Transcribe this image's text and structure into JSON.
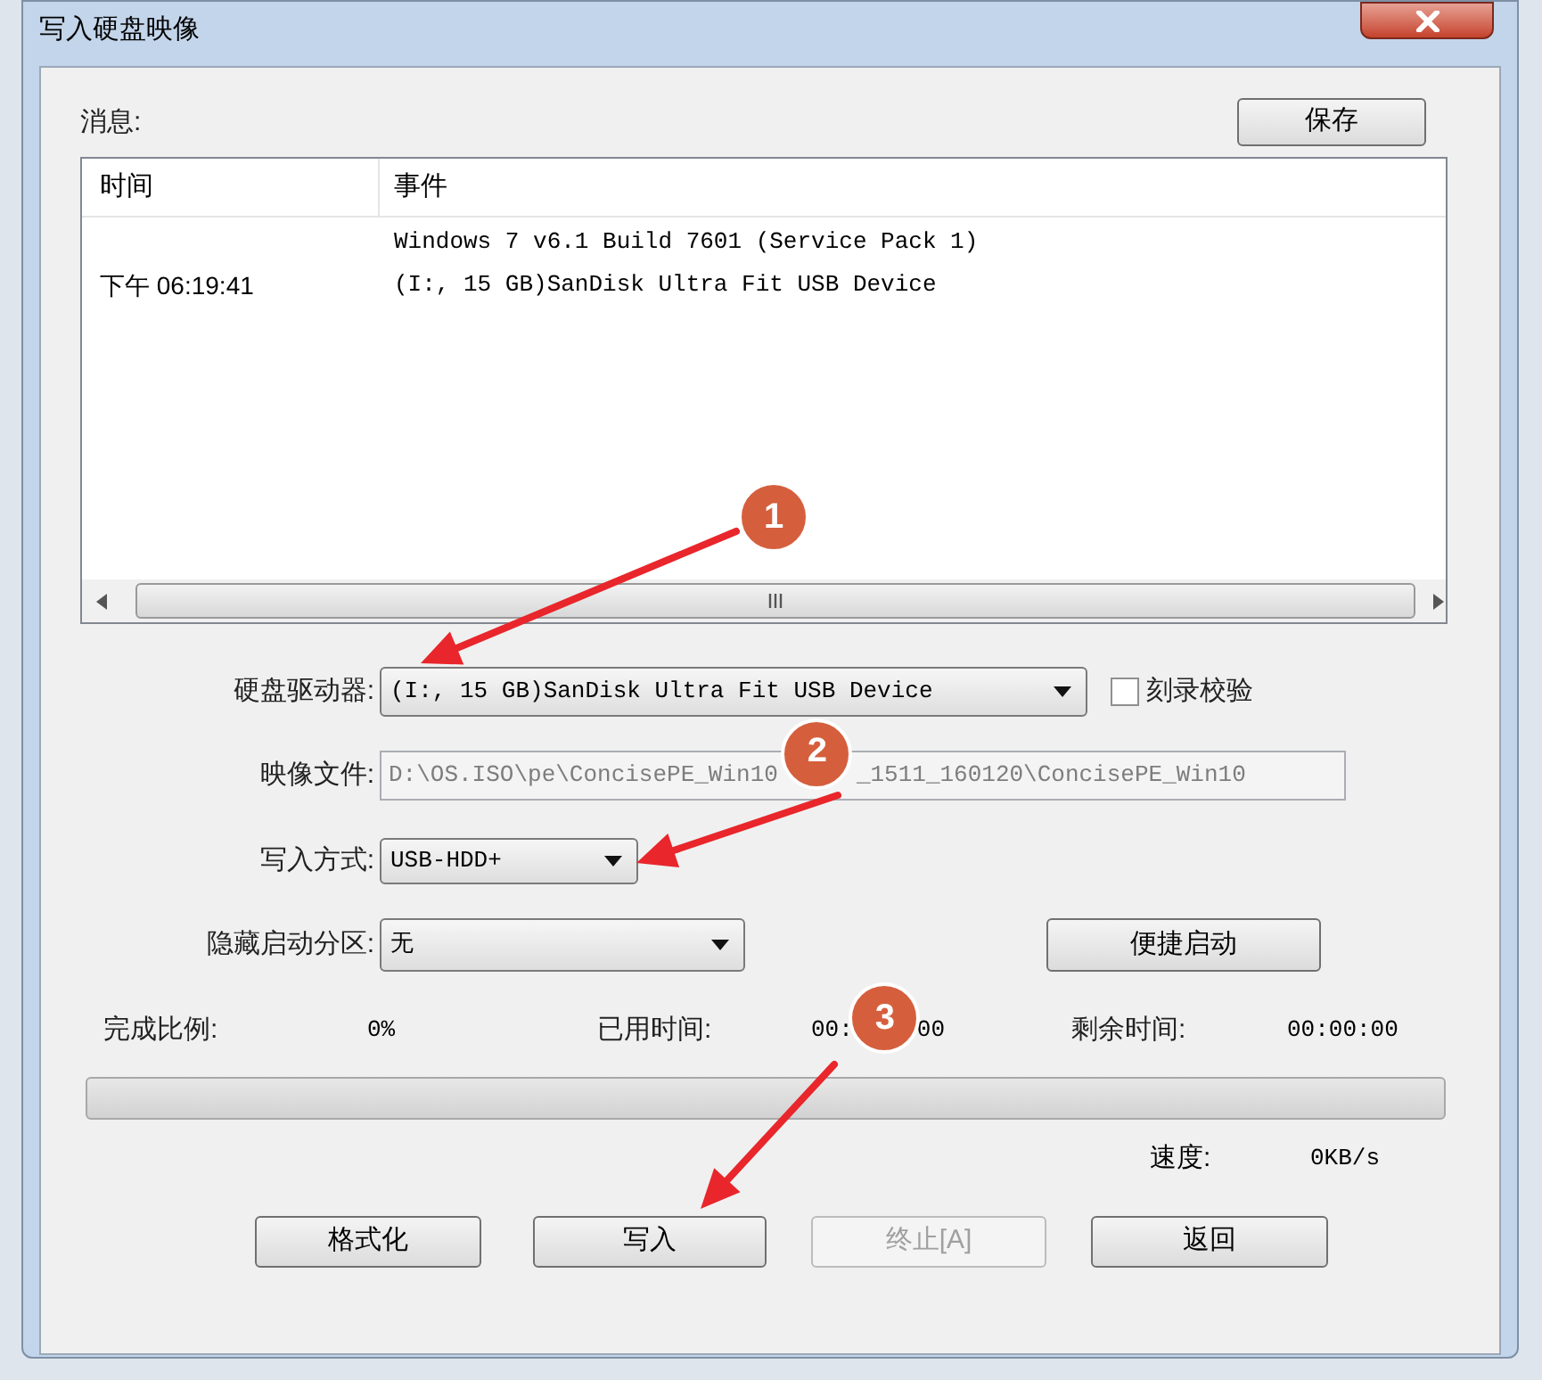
{
  "window": {
    "title": "写入硬盘映像"
  },
  "messages": {
    "label": "消息:",
    "save_button": "保存",
    "columns": [
      "时间",
      "事件"
    ],
    "rows": [
      {
        "time": "下午 06:19:41",
        "event_lines": [
          "Windows 7 v6.1 Build 7601 (Service Pack 1)",
          "(I:, 15 GB)SanDisk Ultra Fit USB Device"
        ]
      }
    ],
    "badge": "1"
  },
  "form": [
    {
      "kind": "combo",
      "label": "硬盘驱动器:",
      "value": "(I:, 15 GB)SanDisk Ultra Fit USB Device",
      "checkbox": {
        "label": "刻录校验",
        "checked": false
      }
    },
    {
      "kind": "text",
      "label": "映像文件:",
      "disabled": true,
      "value_parts": [
        "D:\\OS.ISO\\pe\\ConcisePE_Win10",
        "_1511_160120\\ConcisePE_Win10"
      ],
      "badge": "2"
    },
    {
      "kind": "combo",
      "label": "写入方式:",
      "value": "USB-HDD+"
    },
    {
      "kind": "combo",
      "label": "隐藏启动分区:",
      "value": "无",
      "button": "便捷启动"
    }
  ],
  "stats": [
    {
      "label": "完成比例:",
      "value_parts": [
        "0%"
      ]
    },
    {
      "label": "已用时间:",
      "value_parts": [
        "00:",
        "00"
      ],
      "badge": "3"
    },
    {
      "label": "剩余时间:",
      "value_parts": [
        "00:00:00"
      ]
    }
  ],
  "progress": {
    "level": 0
  },
  "speed": {
    "label": "速度:",
    "value": "0KB/s"
  },
  "buttons": [
    {
      "label": "格式化",
      "disabled": false
    },
    {
      "label": "写入",
      "disabled": false
    },
    {
      "label": "终止[A]",
      "disabled": true
    },
    {
      "label": "返回",
      "disabled": false
    }
  ]
}
